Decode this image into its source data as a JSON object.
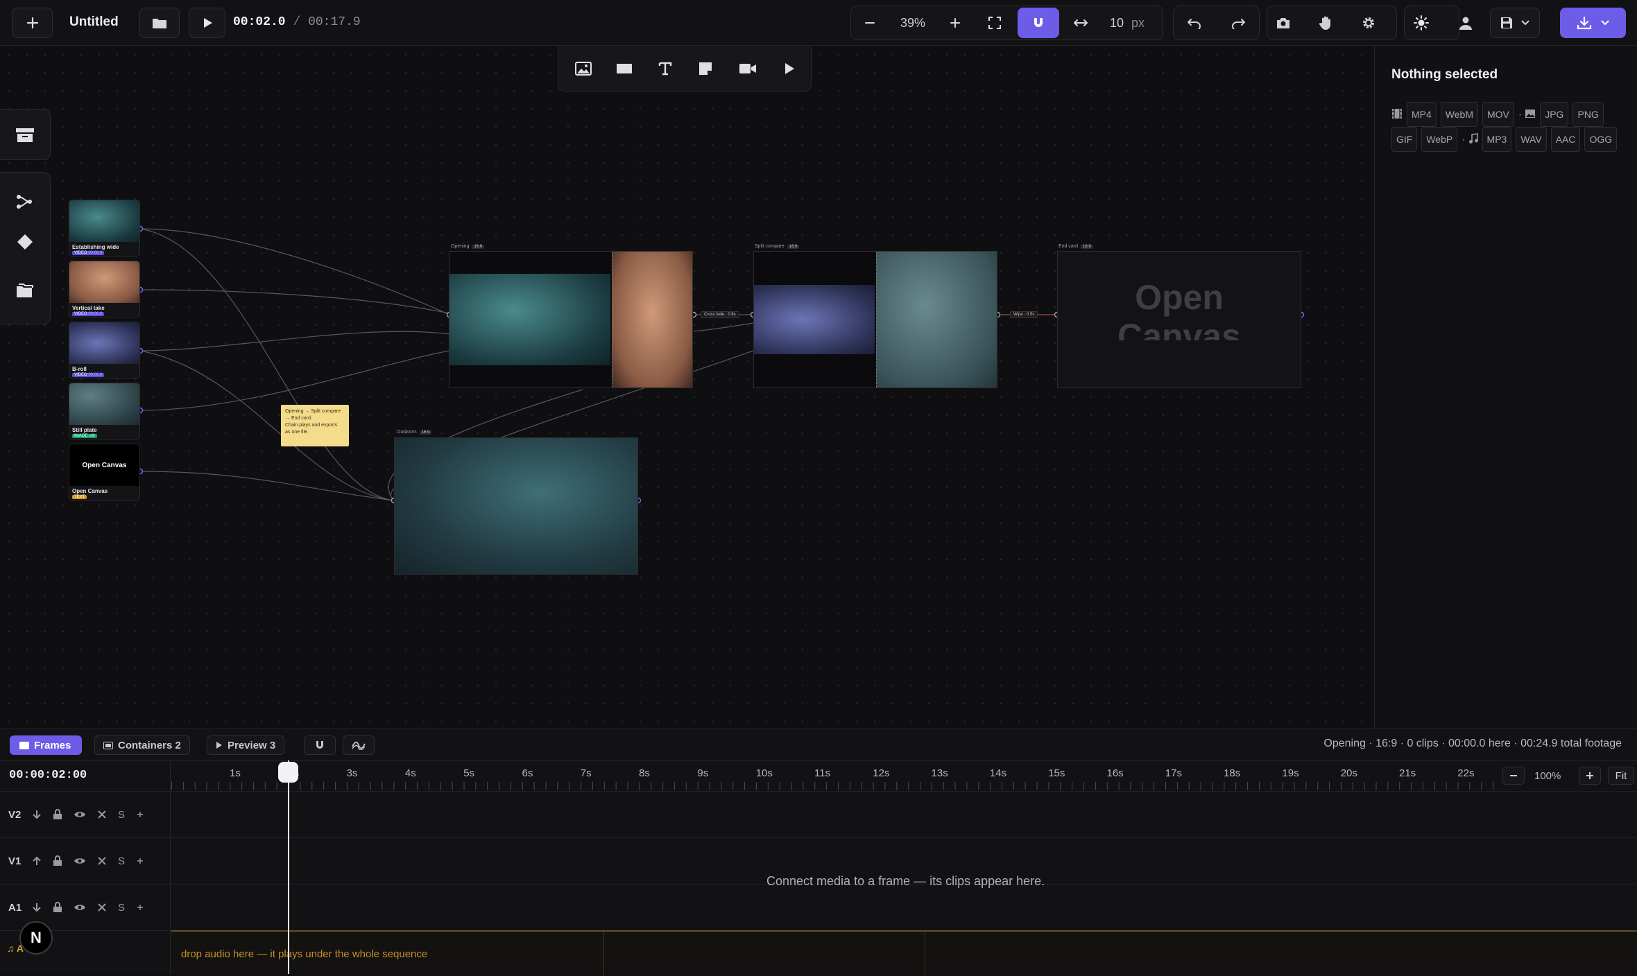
{
  "app": {
    "title": "Untitled",
    "time_current": "00:02.0",
    "time_sep": "/",
    "time_total": "00:17.9"
  },
  "toolbar": {
    "zoom": "39%",
    "snap_value": "10",
    "snap_unit": "px"
  },
  "right_panel": {
    "title": "Nothing selected",
    "video_formats": [
      "MP4",
      "WebM",
      "MOV"
    ],
    "image_formats": [
      "JPG",
      "PNG",
      "GIF",
      "WebP"
    ],
    "audio_formats": [
      "MP3",
      "WAV",
      "AAC",
      "OGG"
    ],
    "sep": "·"
  },
  "media": [
    {
      "label": "Establishing wide",
      "tag": "VIDEO",
      "dur": "00:06.0",
      "tag_color": "#5b4fe0"
    },
    {
      "label": "Vertical take",
      "tag": "VIDEO",
      "dur": "00:06.0",
      "tag_color": "#5b4fe0"
    },
    {
      "label": "B-roll",
      "tag": "VIDEO",
      "dur": "00:06.0",
      "tag_color": "#5b4fe0"
    },
    {
      "label": "Still plate",
      "tag": "IMAGE",
      "dur": "still",
      "tag_color": "#12a36b"
    },
    {
      "label": "Open Canvas",
      "tag": "TEXT",
      "dur": "",
      "tag_color": "#d69a1c",
      "card_text": "Open Canvas"
    }
  ],
  "frames": {
    "opening": {
      "label": "Opening",
      "ratio": "16:9"
    },
    "split": {
      "label": "Split compare",
      "ratio": "16:9"
    },
    "endcard": {
      "label": "End card",
      "ratio": "16:9",
      "text": "Open Canvas"
    },
    "outdoors": {
      "label": "Outdoors",
      "ratio": "16:9"
    }
  },
  "transitions": {
    "t1": "Cross fade · 0.6s",
    "t2": "Wipe · 0.5s"
  },
  "sticky_note": {
    "line1": "Opening → Split compare",
    "line2": "→ End card.",
    "line3": "Chain plays and exports",
    "line4": "as one file."
  },
  "bottom": {
    "tabs": {
      "frames": "Frames",
      "containers": "Containers 2",
      "preview": "Preview 3"
    },
    "status": "Opening · 16:9 · 0 clips · 00:00.0 here · 00:24.9 total footage",
    "timecode": "00:00:02:00",
    "ticks": [
      "1s",
      "2s",
      "3s",
      "4s",
      "5s",
      "6s",
      "7s",
      "8s",
      "9s",
      "10s",
      "11s",
      "12s",
      "13s",
      "14s",
      "15s",
      "16s",
      "17s",
      "18s",
      "19s",
      "20s",
      "21s",
      "22s"
    ],
    "zoom": "100%",
    "fit": "Fit",
    "tracks": [
      "V2",
      "V1",
      "A1"
    ],
    "solo": "S",
    "empty_msg": "Connect media to a frame — its clips appear here.",
    "audio_drop": "drop audio here — it plays under the whole sequence",
    "audio_label": "♫ A",
    "avatar": "N"
  }
}
